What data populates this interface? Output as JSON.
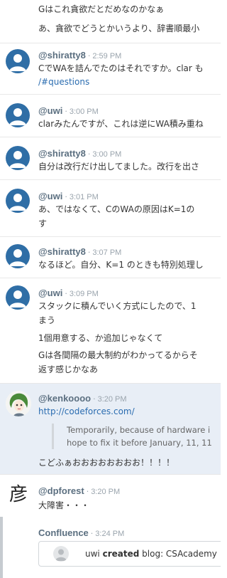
{
  "messages": [
    {
      "id": "m0",
      "continuation": true,
      "lines": [
        "Gはこれ貪欲だとだめなのかなぁ",
        "あ、貪欲でどうとかいうより、辞書順最小"
      ]
    },
    {
      "id": "m1",
      "user": "@shiratty8",
      "time": "2:59 PM",
      "lines": [
        "CでWAを詰んでたのはそれですか。clar も",
        "/#questions"
      ]
    },
    {
      "id": "m2",
      "user": "@uwi",
      "time": "3:00 PM",
      "lines": [
        "clarみたんですが、これは逆にWA積み重ね"
      ]
    },
    {
      "id": "m3",
      "user": "@shiratty8",
      "time": "3:00 PM",
      "lines": [
        "自分は改行だけ出してました。改行を出さ"
      ]
    },
    {
      "id": "m4",
      "user": "@uwi",
      "time": "3:01 PM",
      "lines": [
        "あ、ではなくて、CのWAの原因はK=1の",
        "す"
      ]
    },
    {
      "id": "m5",
      "user": "@shiratty8",
      "time": "3:07 PM",
      "lines": [
        "なるほど。自分、K=1 のときも特別処理し"
      ]
    },
    {
      "id": "m6",
      "user": "@uwi",
      "time": "3:09 PM",
      "lines": [
        "スタックに積んでいく方式にしたので、1",
        "まう",
        "1個用意する、か追加じゃなくて",
        "Gは各間隔の最大制約がわかってるからそ",
        "返す感じかなあ"
      ]
    },
    {
      "id": "m7",
      "user": "@kenkoooo",
      "time": "3:20 PM",
      "link": "http://codeforces.com/",
      "quote": [
        "Temporarily, because of hardware i",
        "hope to fix it before January, 11, 11"
      ],
      "lines": [
        "こどふぁおおおおおおおお！！！！"
      ]
    },
    {
      "id": "m8",
      "user": "@dpforest",
      "time": "3:20 PM",
      "avatar_char": "彦",
      "lines": [
        "大障害・・・"
      ]
    }
  ],
  "confluence": {
    "user": "Confluence",
    "time": "3:24 PM",
    "card": {
      "actor": "uwi",
      "action": "created",
      "rest": "blog: CSAcademy"
    }
  },
  "colors": {
    "username": "#5b6f80",
    "link": "#2a6cb0",
    "highlight_bg": "#e8eef6",
    "avatar_blue": "#2f6ea6"
  },
  "icons": {
    "default_avatar": "person-avatar-icon"
  }
}
